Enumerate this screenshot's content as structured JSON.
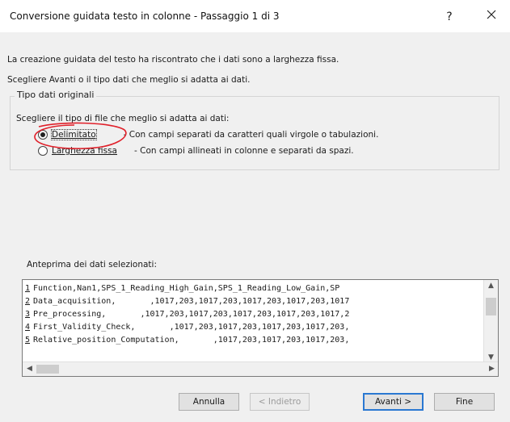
{
  "dialog": {
    "title": "Conversione guidata testo in colonne - Passaggio 1 di 3",
    "help": "?",
    "description1": "La creazione guidata del testo ha riscontrato che i dati sono a larghezza fissa.",
    "description2": "Scegliere Avanti o il tipo dati che meglio si adatta ai dati."
  },
  "group": {
    "legend": "Tipo dati originali",
    "prompt": "Scegliere il tipo di file che meglio si adatta ai dati:",
    "options": [
      {
        "label": "Delimitato",
        "desc": "- Con campi separati da caratteri quali virgole o tabulazioni.",
        "checked": true
      },
      {
        "label": "Larghezza fissa",
        "desc": "- Con campi allineati in colonne e separati da spazi.",
        "checked": false
      }
    ]
  },
  "annotation": {
    "color": "#e0202a"
  },
  "preview": {
    "label": "Anteprima dei dati selezionati:",
    "lines": [
      {
        "num": "1",
        "text": "Function,Nan1,SPS_1_Reading_High_Gain,SPS_1_Reading_Low_Gain,SP"
      },
      {
        "num": "2",
        "text": "Data_acquisition,       ,1017,203,1017,203,1017,203,1017,203,1017"
      },
      {
        "num": "3",
        "text": "Pre_processing,       ,1017,203,1017,203,1017,203,1017,203,1017,2"
      },
      {
        "num": "4",
        "text": "First_Validity_Check,       ,1017,203,1017,203,1017,203,1017,203,"
      },
      {
        "num": "5",
        "text": "Relative_position_Computation,       ,1017,203,1017,203,1017,203,"
      }
    ]
  },
  "buttons": {
    "cancel": "Annulla",
    "back": "< Indietro",
    "next": "Avanti >",
    "finish": "Fine"
  }
}
